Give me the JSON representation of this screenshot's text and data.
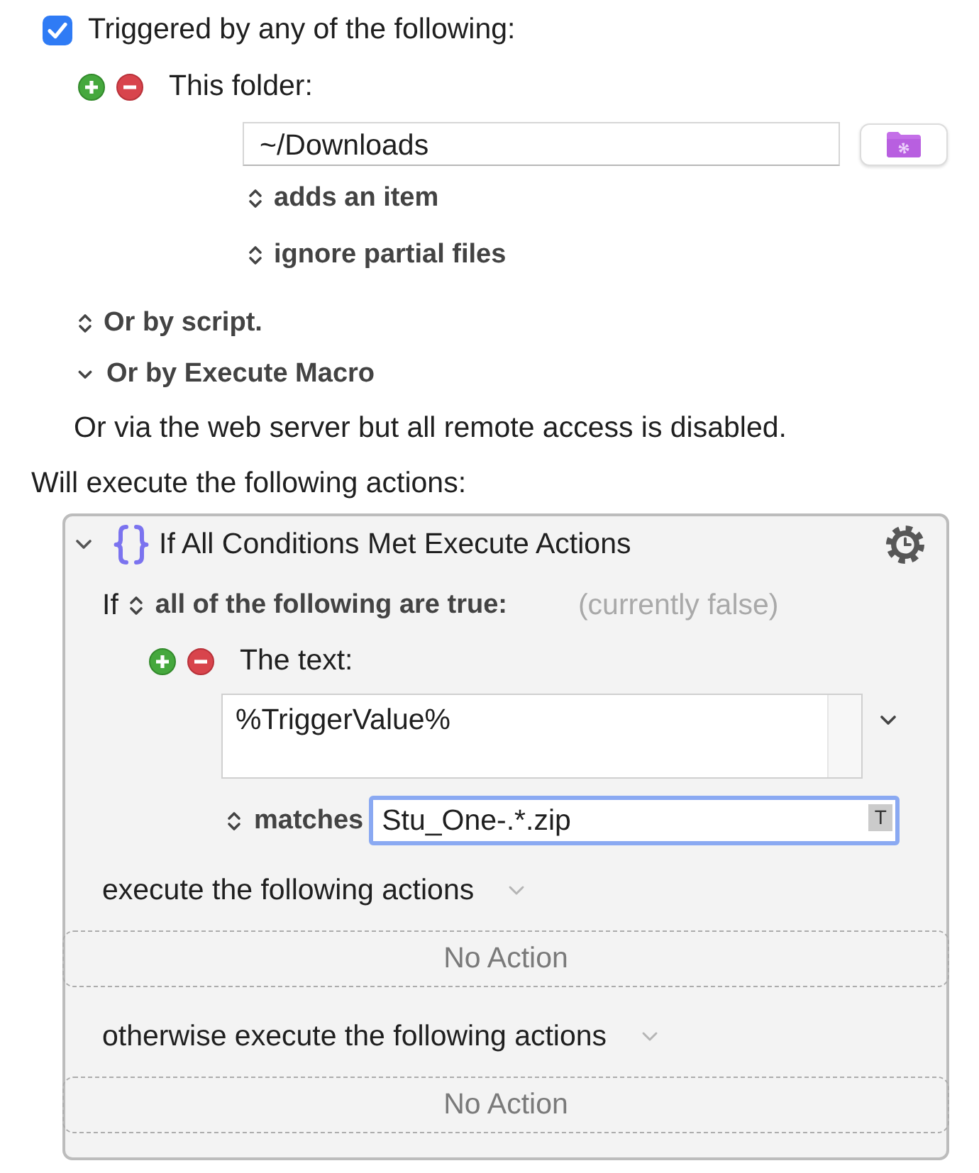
{
  "trigger": {
    "checked": true,
    "label": "Triggered by any of the following:"
  },
  "folder_trigger": {
    "label": "This folder:",
    "path": "~/Downloads",
    "event": "adds an item",
    "option": "ignore partial files"
  },
  "other_triggers": [
    {
      "kind": "popup",
      "label": "Or by script."
    },
    {
      "kind": "disclosure",
      "label": "Or by Execute Macro"
    }
  ],
  "web_server_note": "Or via the web server but all remote access is disabled.",
  "actions_heading": "Will execute the following actions:",
  "action": {
    "expanded": true,
    "title": "If All Conditions Met Execute Actions",
    "condition_prefix": "If",
    "condition_mode": "all of the following are true:",
    "status": "(currently false)",
    "conditions": [
      {
        "label": "The text:",
        "text": "%TriggerValue%",
        "operator": "matches",
        "pattern": "Stu_One-.*.zip",
        "token_button": "T",
        "focused": true
      }
    ],
    "branches": [
      {
        "label": "execute the following actions",
        "empty_label": "No Action"
      },
      {
        "label": "otherwise execute the following actions",
        "empty_label": "No Action"
      }
    ]
  }
}
